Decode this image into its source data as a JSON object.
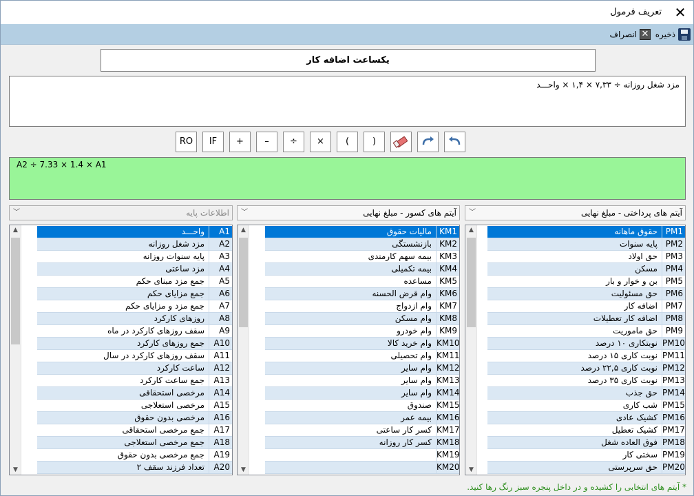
{
  "window": {
    "title": "تعریف فرمول"
  },
  "toolbar": {
    "save_label": "ذخیره",
    "cancel_label": "انصراف"
  },
  "formula_name": "یکساعت اضافه کار",
  "description": "مزد شغل روزانه ÷ ۷,۳۳ × ۱,۴ × واحـــد",
  "formula": "A2 ÷ 7.33 × 1.4 × A1",
  "operators": [
    {
      "key": "ro",
      "label": "RO"
    },
    {
      "key": "if",
      "label": "IF"
    },
    {
      "key": "plus",
      "label": "+"
    },
    {
      "key": "minus",
      "label": "–"
    },
    {
      "key": "divide",
      "label": "÷"
    },
    {
      "key": "multiply",
      "label": "×"
    },
    {
      "key": "open-paren",
      "label": "("
    },
    {
      "key": "close-paren",
      "label": ")"
    }
  ],
  "panels": {
    "payments": {
      "combo": "آیتم های پرداختی - مبلغ نهایی",
      "items": [
        {
          "code": "PM1",
          "label": "حقوق ماهانه"
        },
        {
          "code": "PM2",
          "label": "پایه سنوات"
        },
        {
          "code": "PM3",
          "label": "حق اولاد"
        },
        {
          "code": "PM4",
          "label": "مسکن"
        },
        {
          "code": "PM5",
          "label": "بن و خوار و بار"
        },
        {
          "code": "PM6",
          "label": "حق مسئولیت"
        },
        {
          "code": "PM7",
          "label": "اضافه کار"
        },
        {
          "code": "PM8",
          "label": "اضافه کار تعطیلات"
        },
        {
          "code": "PM9",
          "label": "حق ماموریت"
        },
        {
          "code": "PM10",
          "label": "نوبتکاری ۱۰ درصد"
        },
        {
          "code": "PM11",
          "label": "نوبت کاری ۱۵ درصد"
        },
        {
          "code": "PM12",
          "label": "نوبت کاری ۲۲,۵ درصد"
        },
        {
          "code": "PM13",
          "label": "نوبت کاری ۳۵ درصد"
        },
        {
          "code": "PM14",
          "label": "حق جذب"
        },
        {
          "code": "PM15",
          "label": "شب کاری"
        },
        {
          "code": "PM16",
          "label": "کشیک عادی"
        },
        {
          "code": "PM17",
          "label": "کشیک تعطیل"
        },
        {
          "code": "PM18",
          "label": "فوق العاده شغل"
        },
        {
          "code": "PM19",
          "label": "سختی کار"
        },
        {
          "code": "PM20",
          "label": "حق سرپرستی"
        }
      ]
    },
    "deductions": {
      "combo": "آیتم های کسور - مبلغ نهایی",
      "items": [
        {
          "code": "KM1",
          "label": "مالیات حقوق"
        },
        {
          "code": "KM2",
          "label": "بازنشستگی"
        },
        {
          "code": "KM3",
          "label": "بیمه سهم کارمندی"
        },
        {
          "code": "KM4",
          "label": "بیمه تکمیلی"
        },
        {
          "code": "KM5",
          "label": "مساعده"
        },
        {
          "code": "KM6",
          "label": "وام قرض الحسنه"
        },
        {
          "code": "KM7",
          "label": "وام ازدواج"
        },
        {
          "code": "KM8",
          "label": "وام مسکن"
        },
        {
          "code": "KM9",
          "label": "وام خودرو"
        },
        {
          "code": "KM10",
          "label": "وام خرید کالا"
        },
        {
          "code": "KM11",
          "label": "وام تحصیلی"
        },
        {
          "code": "KM12",
          "label": "وام سایر"
        },
        {
          "code": "KM13",
          "label": "وام سایر"
        },
        {
          "code": "KM14",
          "label": "وام سایر"
        },
        {
          "code": "KM15",
          "label": "صندوق"
        },
        {
          "code": "KM16",
          "label": "بیمه عمر"
        },
        {
          "code": "KM17",
          "label": "کسر کار ساعتی"
        },
        {
          "code": "KM18",
          "label": "کسر کار روزانه"
        },
        {
          "code": "KM19",
          "label": ""
        },
        {
          "code": "KM20",
          "label": ""
        }
      ]
    },
    "base": {
      "combo": "اطلاعات پایه",
      "items": [
        {
          "code": "A1",
          "label": "واحـــد"
        },
        {
          "code": "A2",
          "label": "مزد شغل روزانه"
        },
        {
          "code": "A3",
          "label": "پایه سنوات روزانه"
        },
        {
          "code": "A4",
          "label": "مزد ساعتی"
        },
        {
          "code": "A5",
          "label": "جمع مزد مبنای حکم"
        },
        {
          "code": "A6",
          "label": "جمع مزایای حکم"
        },
        {
          "code": "A7",
          "label": "جمع مزد و مزایای حکم"
        },
        {
          "code": "A8",
          "label": "روزهای کارکرد"
        },
        {
          "code": "A9",
          "label": "سقف روزهای کارکرد در ماه"
        },
        {
          "code": "A10",
          "label": "جمع روزهای کارکرد"
        },
        {
          "code": "A11",
          "label": "سقف روزهای کارکرد در سال"
        },
        {
          "code": "A12",
          "label": "ساعت کارکرد"
        },
        {
          "code": "A13",
          "label": "جمع ساعت کارکرد"
        },
        {
          "code": "A14",
          "label": "مرخصی استحقاقی"
        },
        {
          "code": "A15",
          "label": "مرخصی استعلاجی"
        },
        {
          "code": "A16",
          "label": "مرخصی بدون حقوق"
        },
        {
          "code": "A17",
          "label": "جمع مرخصی استحقاقی"
        },
        {
          "code": "A18",
          "label": "جمع مرخصی استعلاجی"
        },
        {
          "code": "A19",
          "label": "جمع مرخصی بدون حقوق"
        },
        {
          "code": "A20",
          "label": "تعداد فرزند سقف ۲"
        }
      ]
    }
  },
  "footer_note": "* آیتم های انتخابی را کشیده و در داخل پنجره سبز رنگ رها کنید."
}
